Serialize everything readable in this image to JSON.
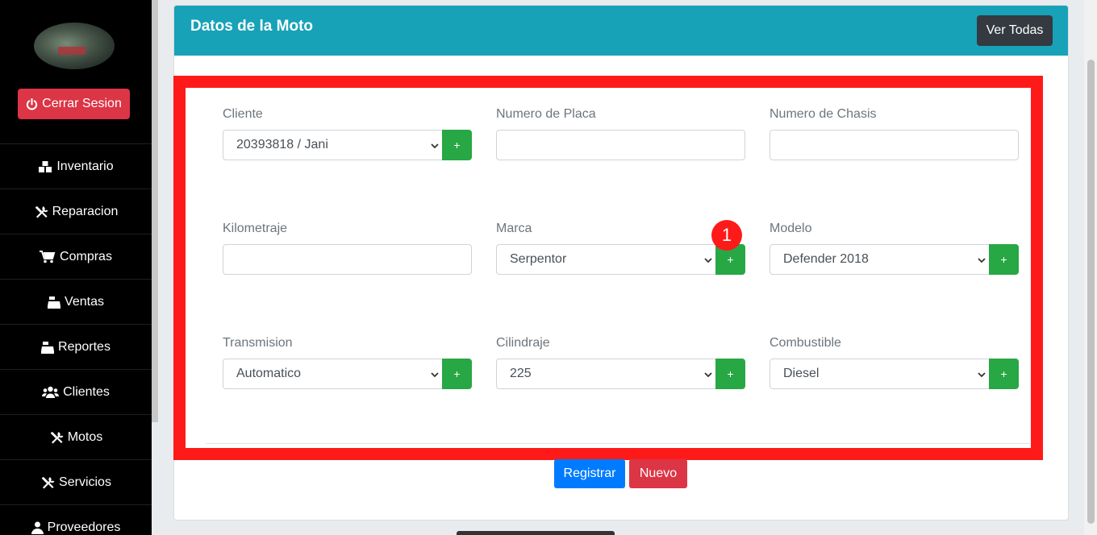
{
  "sidebar": {
    "logout_label": "Cerrar Sesion",
    "items": [
      {
        "label": "Inventario",
        "icon": "boxes-icon"
      },
      {
        "label": "Reparacion",
        "icon": "tools-icon"
      },
      {
        "label": "Compras",
        "icon": "cart-icon"
      },
      {
        "label": "Ventas",
        "icon": "cash-register-icon"
      },
      {
        "label": "Reportes",
        "icon": "cash-register-icon"
      },
      {
        "label": "Clientes",
        "icon": "users-icon"
      },
      {
        "label": "Motos",
        "icon": "tools-icon"
      },
      {
        "label": "Servicios",
        "icon": "tools-icon"
      },
      {
        "label": "Proveedores",
        "icon": "user-icon"
      }
    ]
  },
  "card": {
    "title": "Datos de la Moto",
    "view_all_label": "Ver Todas"
  },
  "form": {
    "cliente": {
      "label": "Cliente",
      "value": "20393818 / Jani"
    },
    "placa": {
      "label": "Numero de Placa",
      "value": ""
    },
    "chasis": {
      "label": "Numero de Chasis",
      "value": ""
    },
    "kilometraje": {
      "label": "Kilometraje",
      "value": ""
    },
    "marca": {
      "label": "Marca",
      "value": "Serpentor"
    },
    "modelo": {
      "label": "Modelo",
      "value": "Defender 2018"
    },
    "transmision": {
      "label": "Transmision",
      "value": "Automatico"
    },
    "cilindraje": {
      "label": "Cilindraje",
      "value": "225"
    },
    "combustible": {
      "label": "Combustible",
      "value": "Diesel"
    },
    "add_label": "+"
  },
  "annotation": {
    "badge": "1",
    "color": "#ff1a1a"
  },
  "actions": {
    "register_label": "Registrar",
    "new_label": "Nuevo"
  },
  "colors": {
    "header": "#17a2b8",
    "success": "#28a745",
    "danger": "#dc3545",
    "primary": "#007bff"
  }
}
